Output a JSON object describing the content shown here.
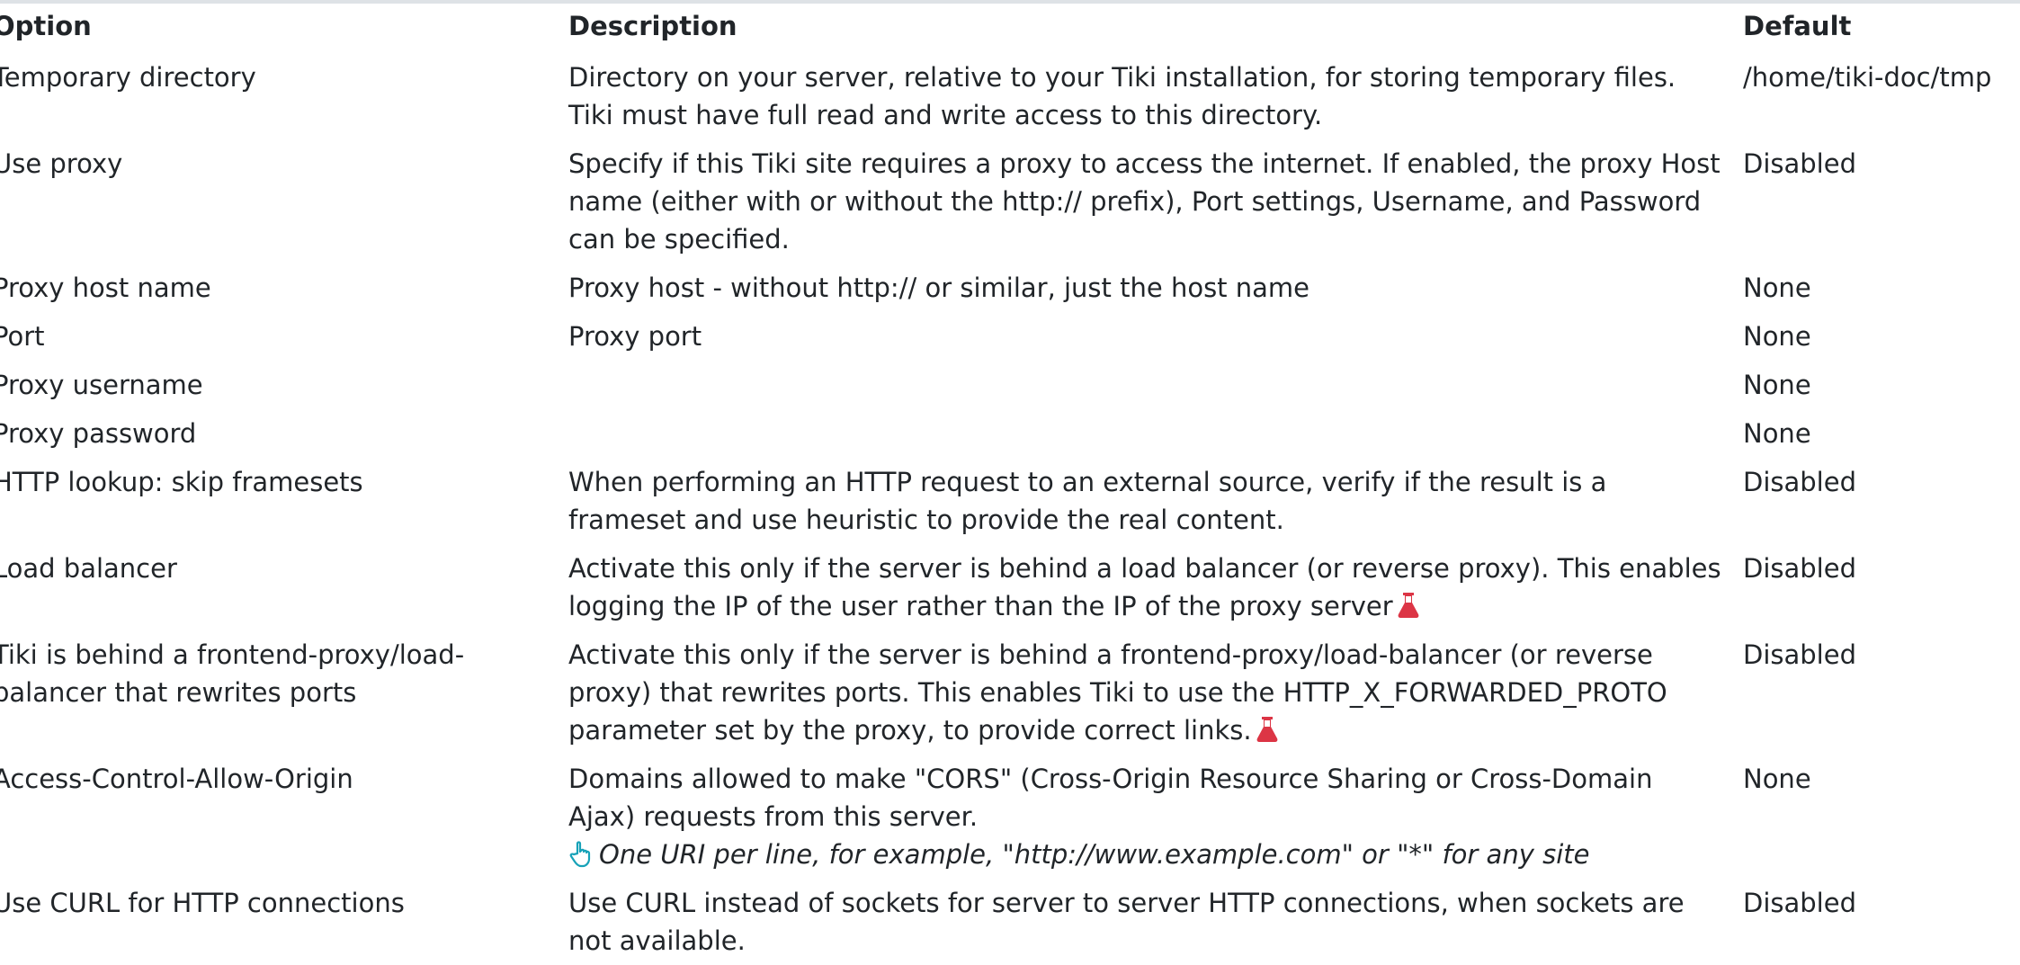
{
  "table": {
    "headers": {
      "option": "Option",
      "description": "Description",
      "default": "Default"
    },
    "rows": [
      {
        "option": "Temporary directory",
        "description": "Directory on your server, relative to your Tiki installation, for storing temporary files. Tiki must have full read and write access to this directory.",
        "default": "/home/tiki-doc/tmp"
      },
      {
        "option": "Use proxy",
        "description": "Specify if this Tiki site requires a proxy to access the internet. If enabled, the proxy Host name (either with or without the http:// prefix), Port settings, Username, and Password can be specified.",
        "default": "Disabled"
      },
      {
        "option": "Proxy host name",
        "description": "Proxy host - without http:// or similar, just the host name",
        "default": "None"
      },
      {
        "option": "Port",
        "description": "Proxy port",
        "default": "None"
      },
      {
        "option": "Proxy username",
        "description": "",
        "default": "None"
      },
      {
        "option": "Proxy password",
        "description": "",
        "default": "None"
      },
      {
        "option": "HTTP lookup: skip framesets",
        "description": "When performing an HTTP request to an external source, verify if the result is a frameset and use heuristic to provide the real content.",
        "default": "Disabled"
      },
      {
        "option": "Load balancer",
        "description": "Activate this only if the server is behind a load balancer (or reverse proxy). This enables logging the IP of the user rather than the IP of the proxy server",
        "default": "Disabled",
        "experimental": true
      },
      {
        "option": "Tiki is behind a frontend-proxy/load-balancer that rewrites ports",
        "description": "Activate this only if the server is behind a frontend-proxy/load-balancer (or reverse proxy) that rewrites ports. This enables Tiki to use the HTTP_X_FORWARDED_PROTO parameter set by the proxy, to provide correct links.",
        "default": "Disabled",
        "experimental": true
      },
      {
        "option": "Access-Control-Allow-Origin",
        "description": "Domains allowed to make \"CORS\" (Cross-Origin Resource Sharing or Cross-Domain Ajax) requests from this server.",
        "hint": "One URI per line, for example, \"http://www.example.com\" or \"*\" for any site",
        "default": "None"
      },
      {
        "option": "Use CURL for HTTP connections",
        "description": "Use CURL instead of sockets for server to server HTTP connections, when sockets are not available.",
        "default": "Disabled"
      }
    ]
  },
  "colors": {
    "text": "#212529",
    "experimental_icon": "#dc3545",
    "hint_icon": "#17a2b8",
    "border": "#dee2e6"
  },
  "icons": {
    "experimental": "flask-icon",
    "hint": "hand-pointer-icon"
  }
}
